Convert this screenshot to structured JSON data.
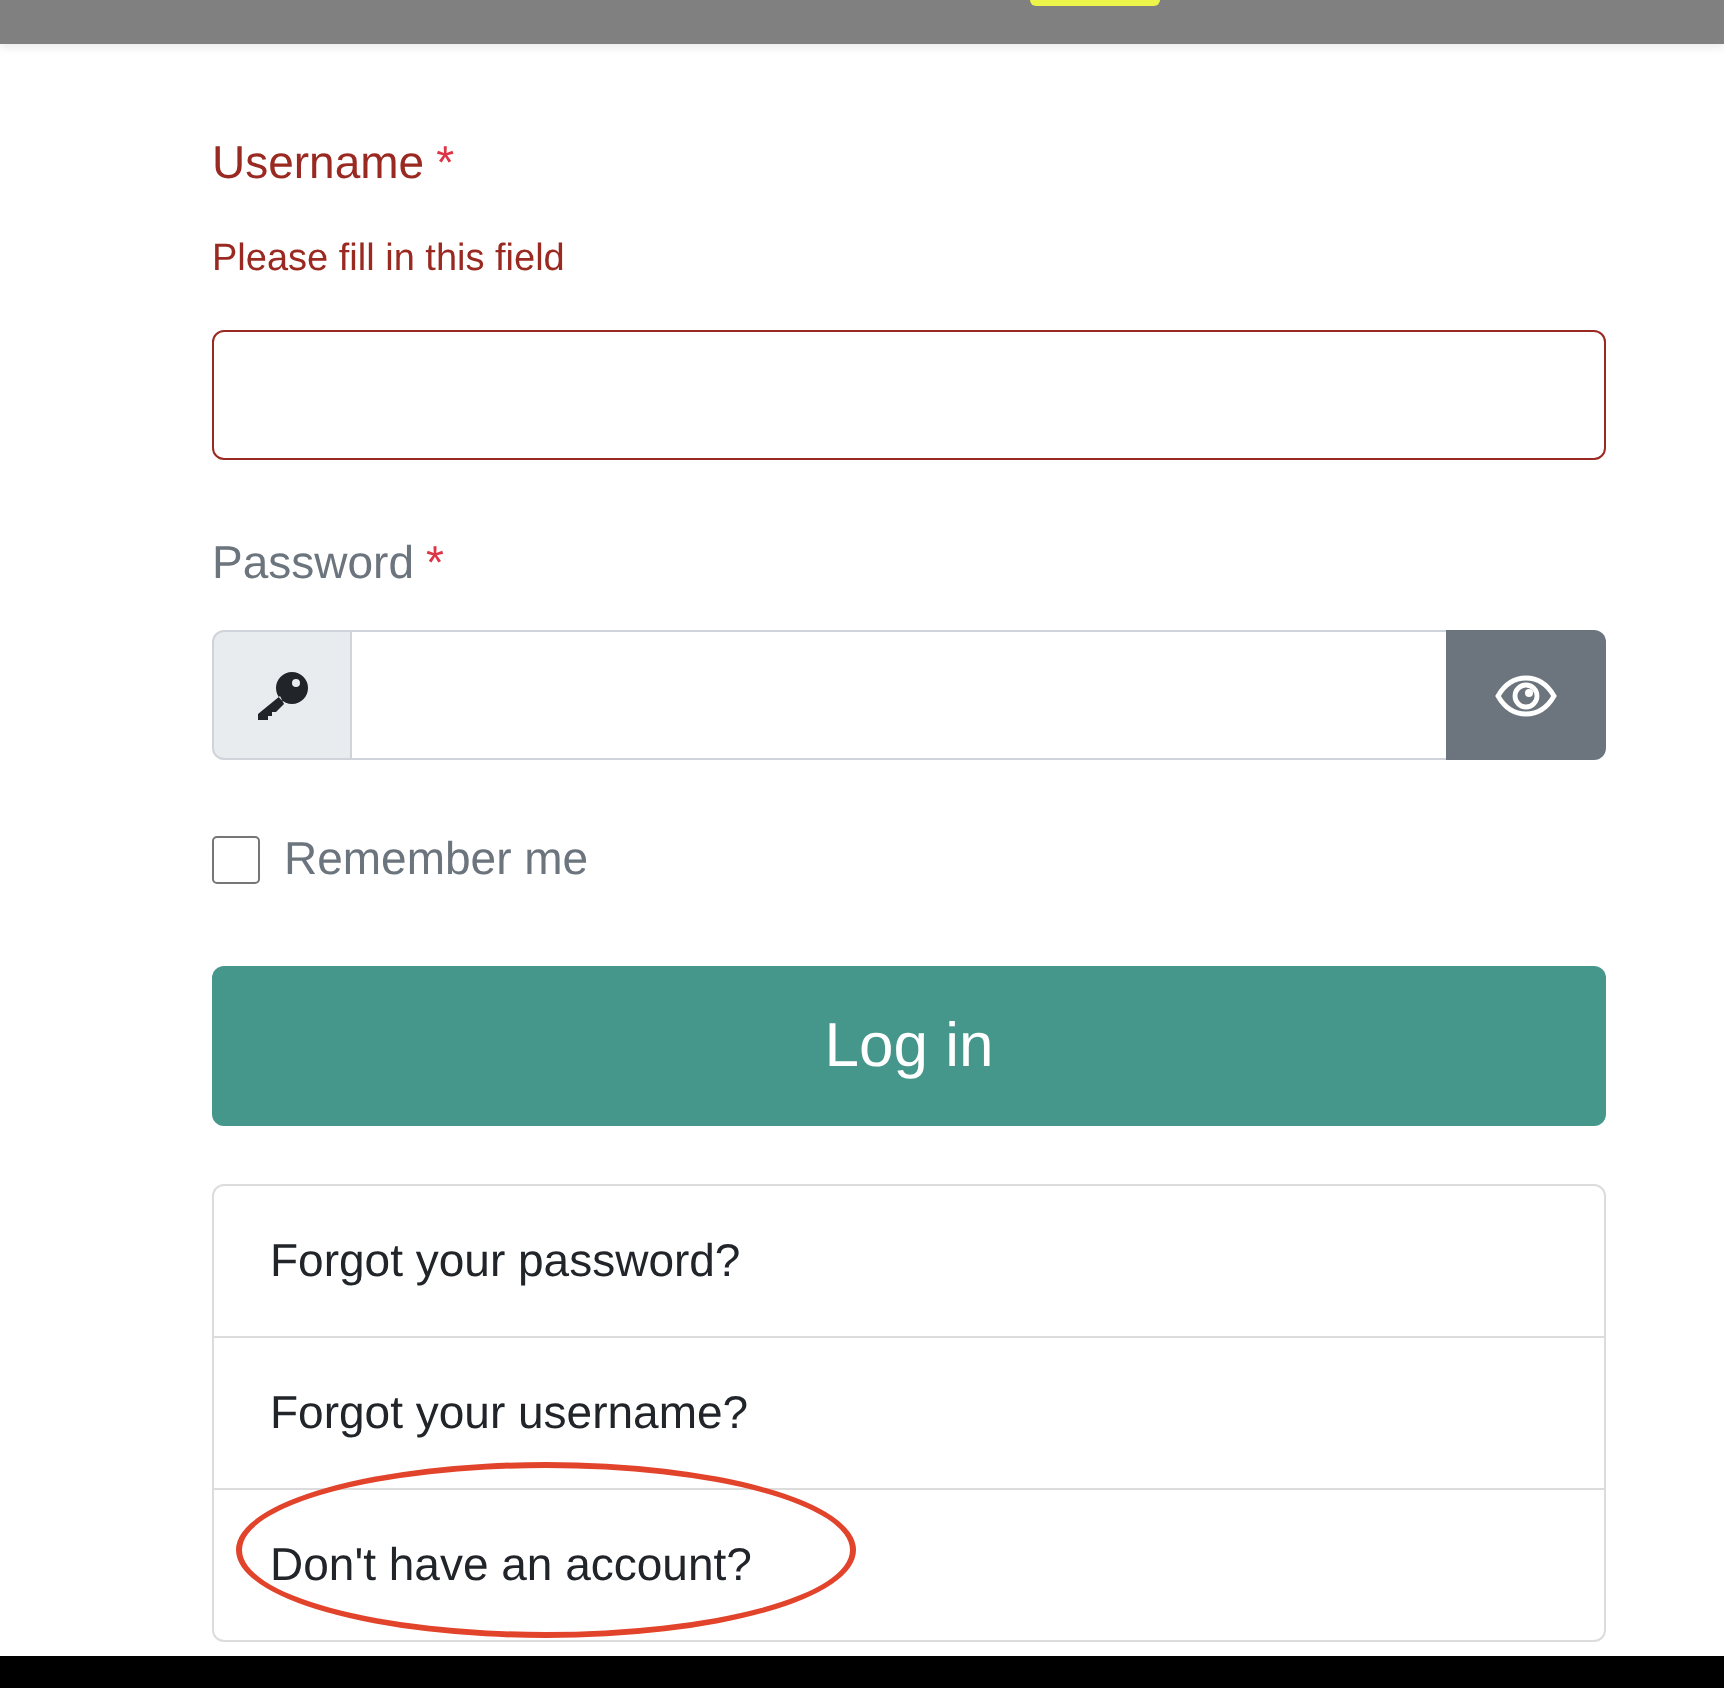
{
  "username": {
    "label": "Username",
    "required_mark": "*",
    "error": "Please fill in this field",
    "invalid": true
  },
  "password": {
    "label": "Password",
    "required_mark": "*",
    "invalid": false
  },
  "remember": {
    "label": "Remember me",
    "checked": false
  },
  "login_button": "Log in",
  "links": [
    {
      "label": "Forgot your password?",
      "circled": false
    },
    {
      "label": "Forgot your username?",
      "circled": false
    },
    {
      "label": "Don't have an account?",
      "circled": true
    }
  ]
}
